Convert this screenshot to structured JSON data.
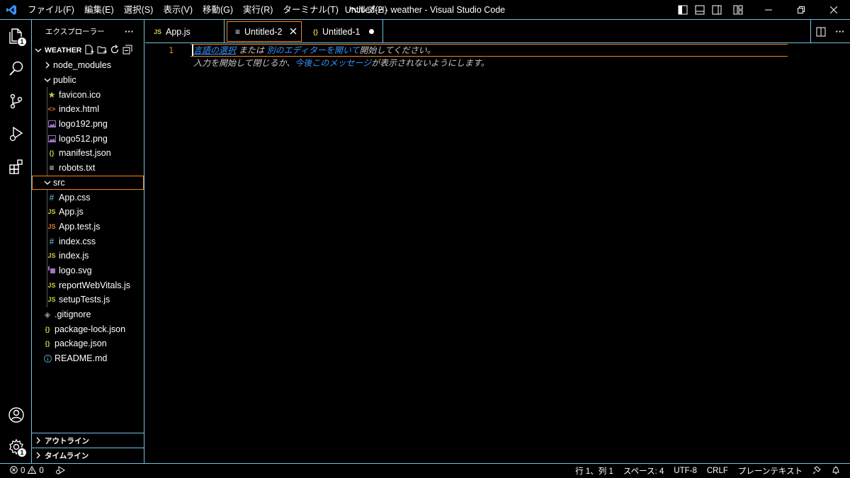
{
  "titlebar": {
    "menu": [
      "ファイル(F)",
      "編集(E)",
      "選択(S)",
      "表示(V)",
      "移動(G)",
      "実行(R)",
      "ターミナル(T)",
      "ヘルプ(H)"
    ],
    "title": "Untitled-2 - weather - Visual Studio Code"
  },
  "activitybar": {
    "explorer_badge": "1",
    "settings_badge": "1"
  },
  "sidebar": {
    "header": "エクスプローラー",
    "more": "···",
    "root": "WEATHER",
    "tree": [
      {
        "label": "node_modules",
        "icon": "chevron-right",
        "depth": 1
      },
      {
        "label": "public",
        "icon": "chevron-down",
        "depth": 1
      },
      {
        "label": "favicon.ico",
        "icon": "star",
        "depth": 2
      },
      {
        "label": "index.html",
        "icon": "html",
        "depth": 2
      },
      {
        "label": "logo192.png",
        "icon": "image",
        "depth": 2
      },
      {
        "label": "logo512.png",
        "icon": "image",
        "depth": 2
      },
      {
        "label": "manifest.json",
        "icon": "json",
        "depth": 2
      },
      {
        "label": "robots.txt",
        "icon": "text",
        "depth": 2
      },
      {
        "label": "src",
        "icon": "chevron-down",
        "depth": 1
      },
      {
        "label": "App.css",
        "icon": "css",
        "depth": 2
      },
      {
        "label": "App.js",
        "icon": "js",
        "depth": 2
      },
      {
        "label": "App.test.js",
        "icon": "js-test",
        "depth": 2
      },
      {
        "label": "index.css",
        "icon": "css",
        "depth": 2
      },
      {
        "label": "index.js",
        "icon": "js",
        "depth": 2
      },
      {
        "label": "logo.svg",
        "icon": "svg",
        "depth": 2
      },
      {
        "label": "reportWebVitals.js",
        "icon": "js",
        "depth": 2
      },
      {
        "label": "setupTests.js",
        "icon": "js",
        "depth": 2
      },
      {
        "label": ".gitignore",
        "icon": "git",
        "depth": 1
      },
      {
        "label": "package-lock.json",
        "icon": "json",
        "depth": 1
      },
      {
        "label": "package.json",
        "icon": "json",
        "depth": 1
      },
      {
        "label": "README.md",
        "icon": "info",
        "depth": 1
      }
    ],
    "outline": "アウトライン",
    "timeline": "タイムライン"
  },
  "tabs": [
    {
      "label": "App.js",
      "icon": "JS"
    },
    {
      "label": "Untitled-2",
      "icon": "≡"
    },
    {
      "label": "Untitled-1",
      "icon": "{}"
    }
  ],
  "editor": {
    "line_number": "1",
    "hint1_a": "言語の選択",
    "hint1_b": " または ",
    "hint1_c": "別のエディターを開いて",
    "hint1_d": "開始してください。",
    "hint2_a": "入力を開始して閉じるか、",
    "hint2_b": "今後このメッセージ",
    "hint2_c": "が表示されないようにします。"
  },
  "statusbar": {
    "errors": "0",
    "warnings": "0",
    "position": "行 1、列 1",
    "spaces": "スペース: 4",
    "encoding": "UTF-8",
    "eol": "CRLF",
    "language": "プレーンテキスト"
  },
  "colors": {
    "accent_border": "#6fc3df",
    "active_border": "#f38518",
    "link": "#3794ff",
    "js": "#cbcb41",
    "css": "#519aba",
    "html": "#e37933",
    "image": "#a074c4",
    "json": "#cbcb41"
  }
}
